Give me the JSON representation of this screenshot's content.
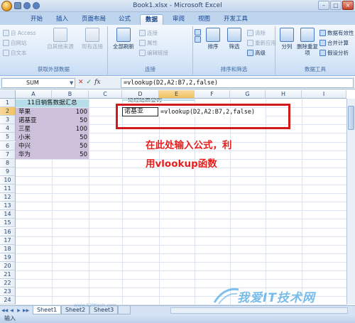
{
  "window": {
    "title": "Book1.xlsx - Microsoft Excel"
  },
  "ribbon": {
    "tabs": [
      "开始",
      "插入",
      "页面布局",
      "公式",
      "数据",
      "审阅",
      "视图",
      "开发工具"
    ],
    "active_tab": "数据",
    "groups": {
      "external": {
        "label": "获取外部数据",
        "access": "自 Access",
        "web": "自网站",
        "text": "自文本",
        "other": "自其他来源",
        "existing": "现有连接"
      },
      "connections": {
        "label": "连接",
        "refresh_all": "全部刷新",
        "connections": "连接",
        "properties": "属性",
        "edit_links": "编辑链接"
      },
      "sort_filter": {
        "label": "排序和筛选",
        "sort": "排序",
        "filter": "筛选",
        "clear": "清除",
        "reapply": "重新应用",
        "advanced": "高级"
      },
      "data_tools": {
        "label": "数据工具",
        "text_to_columns": "分列",
        "remove_dup": "删除重复项",
        "validation": "数据有效性",
        "consolidate": "合并计算",
        "whatif": "假设分析"
      }
    }
  },
  "formula_bar": {
    "name_box": "SUM",
    "fx": "fx",
    "formula": "=vlookup(D2,A2:B7,2,false)"
  },
  "sheet": {
    "columns": [
      "A",
      "B",
      "C",
      "D",
      "E",
      "F",
      "G",
      "H",
      "I"
    ],
    "rows": [
      "1",
      "2",
      "3",
      "4",
      "5",
      "6",
      "7",
      "8",
      "9",
      "10",
      "11",
      "12",
      "13",
      "14",
      "15",
      "16",
      "17",
      "18",
      "19",
      "20",
      "21",
      "22",
      "23",
      "24"
    ],
    "table_header": "11日销售数据汇总",
    "table_rows": [
      {
        "name": "苹果",
        "value": "100"
      },
      {
        "name": "诺基亚",
        "value": "50"
      },
      {
        "name": "三星",
        "value": "100"
      },
      {
        "name": "小米",
        "value": "50"
      },
      {
        "name": "中兴",
        "value": "50"
      },
      {
        "name": "华为",
        "value": "50"
      }
    ],
    "d1_label": "处理结果查询",
    "d2_value": "诺基亚",
    "e2_formula": "=vlookup(D2,A2:B7,2,false)",
    "highlight_color": "#ccc0da",
    "header_color": "#b7dde8"
  },
  "annotation": {
    "line1": "在此处输入公式，利",
    "line2": "用vlookup函数",
    "color": "#e81e1e"
  },
  "sheet_tabs": [
    "Sheet1",
    "Sheet2",
    "Sheet3"
  ],
  "active_sheet": "Sheet1",
  "status": "输入",
  "watermark": {
    "text": "我爱IT技术网",
    "url": "www.52ittech.com"
  }
}
